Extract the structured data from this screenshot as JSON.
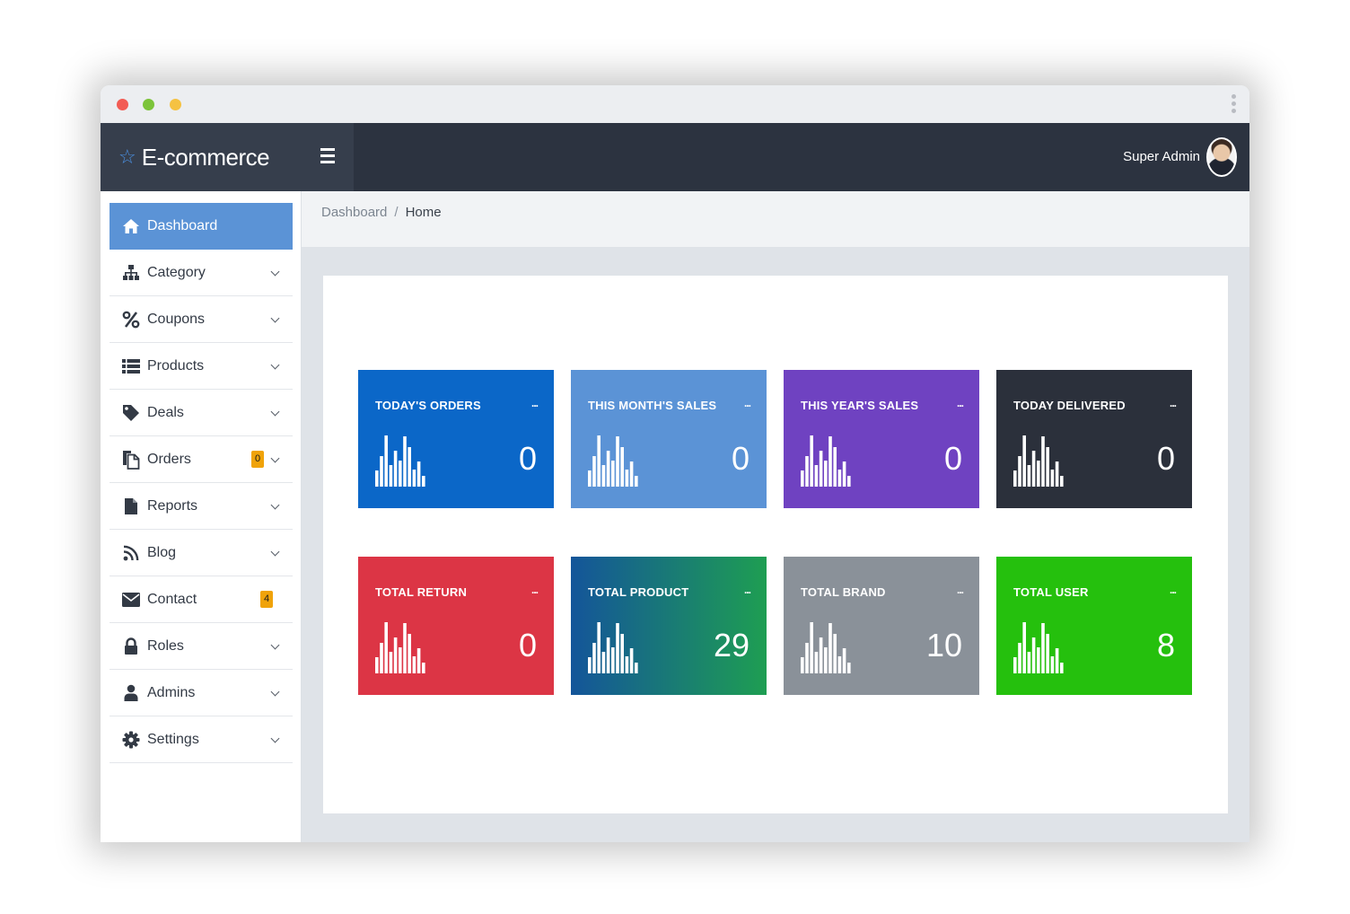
{
  "brand": {
    "name": "E-commerce"
  },
  "user": {
    "name": "Super Admin"
  },
  "sidebar": {
    "items": [
      {
        "label": "Dashboard"
      },
      {
        "label": "Category"
      },
      {
        "label": "Coupons"
      },
      {
        "label": "Products"
      },
      {
        "label": "Deals"
      },
      {
        "label": "Orders",
        "badge": "0"
      },
      {
        "label": "Reports"
      },
      {
        "label": "Blog"
      },
      {
        "label": "Contact",
        "badge": "4"
      },
      {
        "label": "Roles"
      },
      {
        "label": "Admins"
      },
      {
        "label": "Settings"
      }
    ]
  },
  "breadcrumb": {
    "parent": "Dashboard",
    "separator": "/",
    "current": "Home"
  },
  "cards": [
    {
      "title": "TODAY'S ORDERS",
      "value": "0",
      "color": "#0b67c8"
    },
    {
      "title": "THIS MONTH'S SALES",
      "value": "0",
      "color": "#5b93d6"
    },
    {
      "title": "THIS YEAR'S SALES",
      "value": "0",
      "color": "#6f42c1"
    },
    {
      "title": "TODAY DELIVERED",
      "value": "0",
      "color": "#2b303b"
    },
    {
      "title": "TOTAL RETURN",
      "value": "0",
      "color": "#dc3545"
    },
    {
      "title": "TOTAL PRODUCT",
      "value": "29",
      "color": "#14559a"
    },
    {
      "title": "TOTAL BRAND",
      "value": "10",
      "color": "#8a9199"
    },
    {
      "title": "TOTAL USER",
      "value": "8",
      "color": "#25c00d"
    }
  ],
  "card_more": "..."
}
